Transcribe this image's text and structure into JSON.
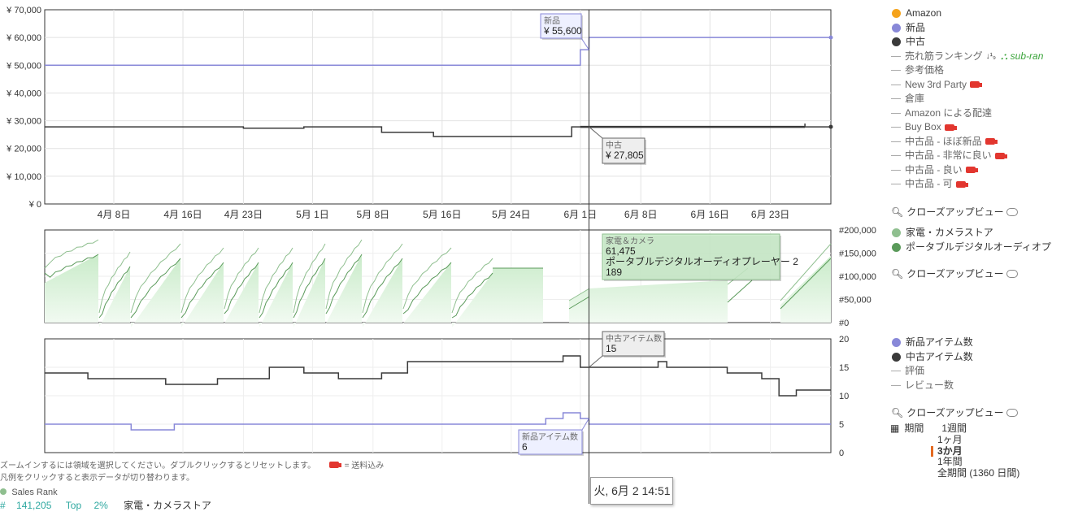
{
  "colors": {
    "amazon": "#f5a31b",
    "new": "#8888d8",
    "used": "#3a3a3a",
    "rank_main": "#8fbf8f",
    "rank_sub": "#5a9a5a",
    "rank_fill": "#d8f0d8",
    "free_shipping": "#e2362f",
    "sub_ran": "#3aa43a"
  },
  "chart_data": [
    {
      "type": "line",
      "panel": "price",
      "ylim": [
        0,
        70000
      ],
      "y_ticks": [
        "¥ 0",
        "¥ 10,000",
        "¥ 20,000",
        "¥ 30,000",
        "¥ 40,000",
        "¥ 50,000",
        "¥ 60,000",
        "¥ 70,000"
      ],
      "x_range": [
        "2020-03-31",
        "2020-06-30"
      ],
      "x_ticks": [
        {
          "date": "2020-04-08",
          "label": "4月 8日"
        },
        {
          "date": "2020-04-16",
          "label": "4月 16日"
        },
        {
          "date": "2020-04-23",
          "label": "4月 23日"
        },
        {
          "date": "2020-05-01",
          "label": "5月 1日"
        },
        {
          "date": "2020-05-08",
          "label": "5月 8日"
        },
        {
          "date": "2020-05-16",
          "label": "5月 16日"
        },
        {
          "date": "2020-05-24",
          "label": "5月 24日"
        },
        {
          "date": "2020-06-01",
          "label": "6月 1日"
        },
        {
          "date": "2020-06-08",
          "label": "6月 8日"
        },
        {
          "date": "2020-06-16",
          "label": "6月 16日"
        },
        {
          "date": "2020-06-23",
          "label": "6月 23日"
        }
      ],
      "series": [
        {
          "name": "新品",
          "color": "#8888d8",
          "points": [
            [
              "2020-03-31",
              50000
            ],
            [
              "2020-06-01",
              50000
            ],
            [
              "2020-06-01",
              55600
            ],
            [
              "2020-06-02",
              55600
            ],
            [
              "2020-06-02",
              60000
            ],
            [
              "2020-06-30",
              60000
            ]
          ]
        },
        {
          "name": "中古",
          "color": "#3a3a3a",
          "points": [
            [
              "2020-03-31",
              27805
            ],
            [
              "2020-04-23",
              27805
            ],
            [
              "2020-04-23",
              27300
            ],
            [
              "2020-04-30",
              27300
            ],
            [
              "2020-04-30",
              27805
            ],
            [
              "2020-05-09",
              27805
            ],
            [
              "2020-05-09",
              25800
            ],
            [
              "2020-05-15",
              25800
            ],
            [
              "2020-05-15",
              24300
            ],
            [
              "2020-05-31",
              24300
            ],
            [
              "2020-05-31",
              27805
            ],
            [
              "2020-06-27",
              27805
            ],
            [
              "2020-06-27",
              29000
            ],
            [
              "2020-06-27",
              27805
            ],
            [
              "2020-06-30",
              27805
            ]
          ]
        }
      ],
      "tooltips": [
        {
          "series": "新品",
          "title": "新品",
          "value": "¥ 55,600"
        },
        {
          "series": "中古",
          "title": "中古",
          "value": "¥ 27,805"
        }
      ]
    },
    {
      "type": "area",
      "panel": "sales_rank",
      "ylim": [
        0,
        200000
      ],
      "y_ticks": [
        "#0",
        "#50,000",
        "#100,000",
        "#150,000",
        "#200,000"
      ],
      "series": [
        {
          "name": "家電・カメラストア",
          "color": "#8fbf8f"
        },
        {
          "name": "ポータブルデジタルオーディオプレーヤー",
          "color": "#5a9a5a"
        }
      ],
      "tooltip": {
        "title": "家電＆カメラ",
        "value1": "61,475",
        "sub_label": "ポータブルデジタルオーディオプレーヤー",
        "sub_icon": "2",
        "value2": "189"
      }
    },
    {
      "type": "line",
      "panel": "offer_count",
      "ylim": [
        0,
        20
      ],
      "y_ticks": [
        "0",
        "5",
        "10",
        "15",
        "20"
      ],
      "series": [
        {
          "name": "新品アイテム数",
          "color": "#8888d8",
          "points": [
            [
              "2020-03-31",
              5
            ],
            [
              "2020-04-10",
              5
            ],
            [
              "2020-04-10",
              4
            ],
            [
              "2020-04-15",
              4
            ],
            [
              "2020-04-15",
              5
            ],
            [
              "2020-05-28",
              5
            ],
            [
              "2020-05-28",
              6
            ],
            [
              "2020-05-30",
              6
            ],
            [
              "2020-05-30",
              7
            ],
            [
              "2020-06-01",
              7
            ],
            [
              "2020-06-01",
              6
            ],
            [
              "2020-06-02",
              6
            ],
            [
              "2020-06-02",
              5
            ],
            [
              "2020-06-30",
              5
            ]
          ]
        },
        {
          "name": "中古アイテム数",
          "color": "#3a3a3a",
          "points": [
            [
              "2020-03-31",
              14
            ],
            [
              "2020-04-05",
              14
            ],
            [
              "2020-04-05",
              13
            ],
            [
              "2020-04-14",
              13
            ],
            [
              "2020-04-14",
              12
            ],
            [
              "2020-04-20",
              12
            ],
            [
              "2020-04-20",
              13
            ],
            [
              "2020-04-26",
              13
            ],
            [
              "2020-04-26",
              15
            ],
            [
              "2020-04-30",
              15
            ],
            [
              "2020-04-30",
              14
            ],
            [
              "2020-05-04",
              14
            ],
            [
              "2020-05-04",
              13
            ],
            [
              "2020-05-09",
              13
            ],
            [
              "2020-05-09",
              14
            ],
            [
              "2020-05-12",
              14
            ],
            [
              "2020-05-12",
              16
            ],
            [
              "2020-05-25",
              16
            ],
            [
              "2020-05-25",
              16
            ],
            [
              "2020-05-30",
              16
            ],
            [
              "2020-05-30",
              17
            ],
            [
              "2020-06-01",
              17
            ],
            [
              "2020-06-01",
              15
            ],
            [
              "2020-06-10",
              15
            ],
            [
              "2020-06-10",
              16
            ],
            [
              "2020-06-11",
              16
            ],
            [
              "2020-06-11",
              15
            ],
            [
              "2020-06-18",
              15
            ],
            [
              "2020-06-18",
              14
            ],
            [
              "2020-06-22",
              14
            ],
            [
              "2020-06-22",
              13
            ],
            [
              "2020-06-24",
              13
            ],
            [
              "2020-06-24",
              10
            ],
            [
              "2020-06-26",
              10
            ],
            [
              "2020-06-26",
              11
            ],
            [
              "2020-06-30",
              11
            ]
          ]
        }
      ],
      "tooltips": [
        {
          "series": "中古アイテム数",
          "title": "中古アイテム数",
          "value": "15"
        },
        {
          "series": "新品アイテム数",
          "title": "新品アイテム数",
          "value": "6"
        }
      ]
    }
  ],
  "crosshair": {
    "date": "2020-06-02",
    "label": "火, 6月 2 14:51"
  },
  "legend_price": [
    {
      "label": "Amazon",
      "marker": "dot",
      "color": "#f5a31b"
    },
    {
      "label": "新品",
      "marker": "dot",
      "color": "#8888d8"
    },
    {
      "label": "中古",
      "marker": "dot",
      "color": "#3a3a3a"
    },
    {
      "label": "売れ筋ランキング",
      "marker": "dash",
      "extra": "sort"
    },
    {
      "label": "参考価格",
      "marker": "dash"
    },
    {
      "label": "New 3rd Party",
      "marker": "dash",
      "truck": true
    },
    {
      "label": "倉庫",
      "marker": "dash"
    },
    {
      "label": "Amazon による配達",
      "marker": "dash"
    },
    {
      "label": "Buy Box",
      "marker": "dash",
      "truck": true
    },
    {
      "label": "中古品 - ほぼ新品",
      "marker": "dash",
      "truck": true
    },
    {
      "label": "中古品 - 非常に良い",
      "marker": "dash",
      "truck": true
    },
    {
      "label": "中古品 - 良い",
      "marker": "dash",
      "truck": true
    },
    {
      "label": "中古品 - 可",
      "marker": "dash",
      "truck": true
    }
  ],
  "sub_ran_label": "sub-ran",
  "legend_rank": [
    {
      "label": "家電・カメラストア",
      "color": "#8fbf8f"
    },
    {
      "label": "ポータブルデジタルオーディオプ",
      "color": "#5a9a5a"
    }
  ],
  "legend_offers": [
    {
      "label": "新品アイテム数",
      "marker": "dot",
      "color": "#8888d8"
    },
    {
      "label": "中古アイテム数",
      "marker": "dot",
      "color": "#3a3a3a"
    },
    {
      "label": "評価",
      "marker": "dash"
    },
    {
      "label": "レビュー数",
      "marker": "dash"
    }
  ],
  "closeup_label": "クローズアップビュー",
  "range": {
    "label": "期間",
    "options": [
      "1週間",
      "1ヶ月",
      "3か月",
      "1年間",
      "全期間 (1360 日間)"
    ],
    "selected": 2
  },
  "footer": {
    "zoom_hint": "ズームインするには領域を選択してください。ダブルクリックするとリセットします。",
    "free_shipping": "= 送料込み",
    "legend_hint": "凡例をクリックすると表示データが切り替わります。"
  },
  "sales_rank": {
    "label": "Sales Rank",
    "hash": "#",
    "value": "141,205",
    "top_label": "Top",
    "top_pct": "2%",
    "category": "家電・カメラストア"
  }
}
